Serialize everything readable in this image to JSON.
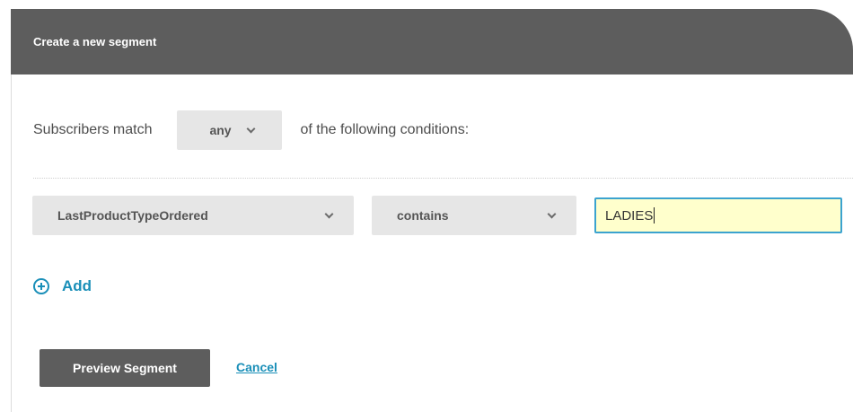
{
  "header": {
    "title": "Create a new segment"
  },
  "match": {
    "prefix": "Subscribers match",
    "selected": "any",
    "suffix": "of the following conditions:"
  },
  "condition": {
    "field": "LastProductTypeOrdered",
    "operator": "contains",
    "value": "LADIES"
  },
  "add": {
    "label": "Add",
    "icon": "plus-circle-icon"
  },
  "actions": {
    "preview_label": "Preview Segment",
    "cancel_label": "Cancel"
  },
  "colors": {
    "header_bg": "#5d5d5d",
    "link": "#1a8fb8",
    "input_bg": "#ffffcc",
    "input_border": "#3ba3cf",
    "select_bg": "#e6e6e6"
  }
}
